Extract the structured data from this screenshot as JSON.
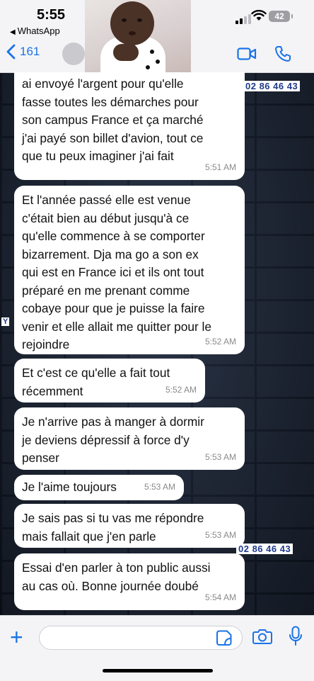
{
  "status_bar": {
    "time": "5:55",
    "back_app": "WhatsApp",
    "battery": "42"
  },
  "header": {
    "back_count": "161"
  },
  "watermark": {
    "number": "02 86 46 43",
    "side_letter": "Y"
  },
  "messages": [
    {
      "text": "ai envoyé l'argent pour qu'elle\nfasse toutes les démarches pour\nson campus France et ça marché\nj'ai payé son billet d'avion, tout ce\nque tu peux imaginer j'ai fait",
      "time": "5:51 AM"
    },
    {
      "text": "Et l'année passé elle est venue\nc'était bien au début jusqu'à ce\nqu'elle commence à se comporter\nbizarrement. Dja ma go a son ex\nqui est en France ici et ils ont tout\npréparé en me prenant comme\ncobaye pour que je puisse la faire\nvenir et elle allait me quitter pour le\nrejoindre",
      "time": "5:52 AM"
    },
    {
      "text": "Et c'est ce qu'elle a fait tout\nrécemment",
      "time": "5:52 AM"
    },
    {
      "text": "Je n'arrive pas à manger à dormir\nje deviens dépressif à force d'y\npenser",
      "time": "5:53 AM"
    },
    {
      "text": "Je l'aime toujours",
      "time": "5:53 AM"
    },
    {
      "text": "Je sais pas si tu vas me répondre\nmais fallait que j'en parle",
      "time": "5:53 AM"
    },
    {
      "text": "Essai d'en parler à ton public aussi\nau cas où. Bonne journée doubé",
      "time": "5:54 AM"
    }
  ],
  "colors": {
    "accent": "#1a73e8",
    "bubble": "#ffffff",
    "wallpaper": "#1c2433"
  }
}
